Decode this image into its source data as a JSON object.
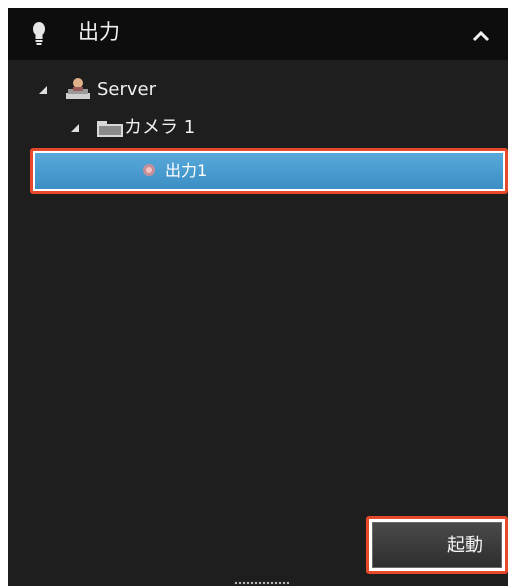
{
  "header": {
    "title": "出力",
    "icon": "lightbulb-icon",
    "collapse_icon": "chevron-up-icon"
  },
  "tree": {
    "server": {
      "label": "Server",
      "icon": "server-icon",
      "expanded": true
    },
    "camera": {
      "label": "カメラ 1",
      "icon": "folder-icon",
      "expanded": true
    },
    "output": {
      "label": "出力1",
      "icon": "output-icon",
      "selected": true
    }
  },
  "actions": {
    "start_label": "起動"
  },
  "colors": {
    "panel_bg": "#1e1e1e",
    "header_bg": "#0d0d0d",
    "selection": "#4a9fd3",
    "highlight_outline": "#e8492b"
  }
}
